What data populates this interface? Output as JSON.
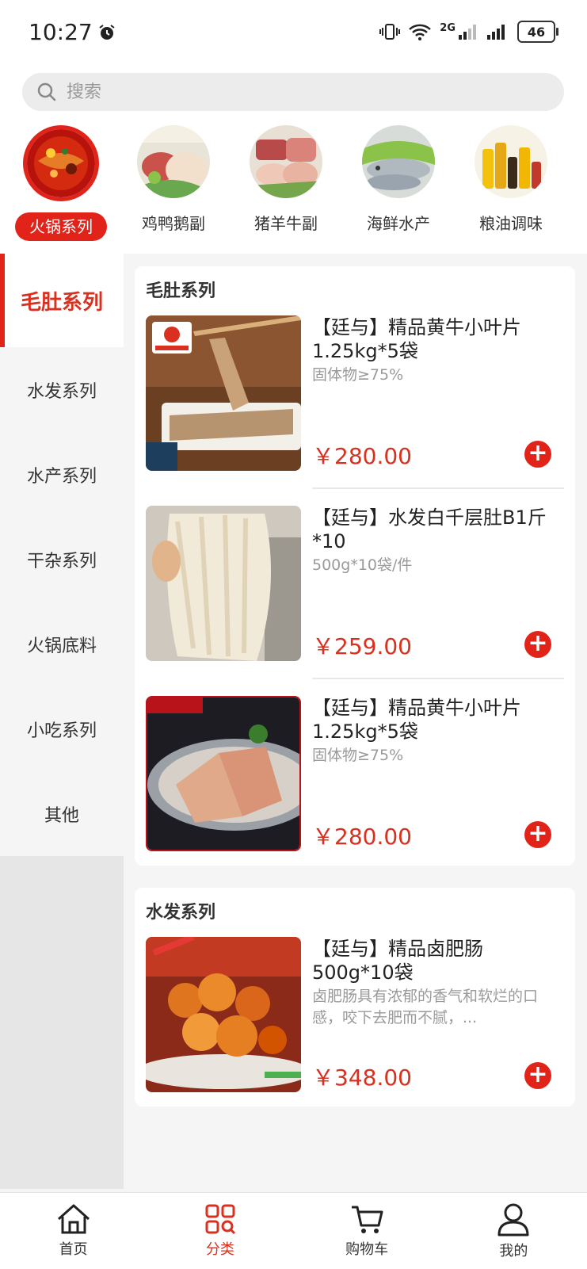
{
  "status_bar": {
    "time": "10:27",
    "network": "2G",
    "battery": "46"
  },
  "search": {
    "placeholder": "搜索"
  },
  "categories": [
    {
      "label": "火锅系列",
      "active": true
    },
    {
      "label": "鸡鸭鹅副",
      "active": false
    },
    {
      "label": "猪羊牛副",
      "active": false
    },
    {
      "label": "海鲜水产",
      "active": false
    },
    {
      "label": "粮油调味",
      "active": false
    }
  ],
  "sidebar": {
    "items": [
      {
        "label": "毛肚系列",
        "active": true
      },
      {
        "label": "水发系列",
        "active": false
      },
      {
        "label": "水产系列",
        "active": false
      },
      {
        "label": "干杂系列",
        "active": false
      },
      {
        "label": "火锅底料",
        "active": false
      },
      {
        "label": "小吃系列",
        "active": false
      },
      {
        "label": "其他",
        "active": false
      }
    ]
  },
  "sections": [
    {
      "title": "毛肚系列",
      "products": [
        {
          "name": "【廷与】精品黄牛小叶片1.25kg*5袋",
          "desc": "固体物≥75%",
          "price": "￥280.00",
          "image": "tripe-slices-chopsticks"
        },
        {
          "name": "【廷与】水发白千层肚B1斤*10",
          "desc": "500g*10袋/件",
          "price": "￥259.00",
          "image": "white-tripe-strips"
        },
        {
          "name": "【廷与】精品黄牛小叶片1.25kg*5袋",
          "desc": "固体物≥75%",
          "price": "￥280.00",
          "image": "tripe-plate"
        }
      ]
    },
    {
      "title": "水发系列",
      "products": [
        {
          "name": "【廷与】精品卤肥肠500g*10袋",
          "desc": "卤肥肠具有浓郁的香气和软烂的口感，咬下去肥而不腻，...",
          "price": "￥348.00",
          "image": "braised-intestine"
        }
      ]
    }
  ],
  "tabbar": {
    "items": [
      {
        "label": "首页",
        "icon": "home-icon",
        "active": false
      },
      {
        "label": "分类",
        "icon": "category-icon",
        "active": true
      },
      {
        "label": "购物车",
        "icon": "cart-icon",
        "active": false
      },
      {
        "label": "我的",
        "icon": "profile-icon",
        "active": false
      }
    ]
  },
  "colors": {
    "accent": "#e2231a",
    "price": "#d9301f"
  }
}
